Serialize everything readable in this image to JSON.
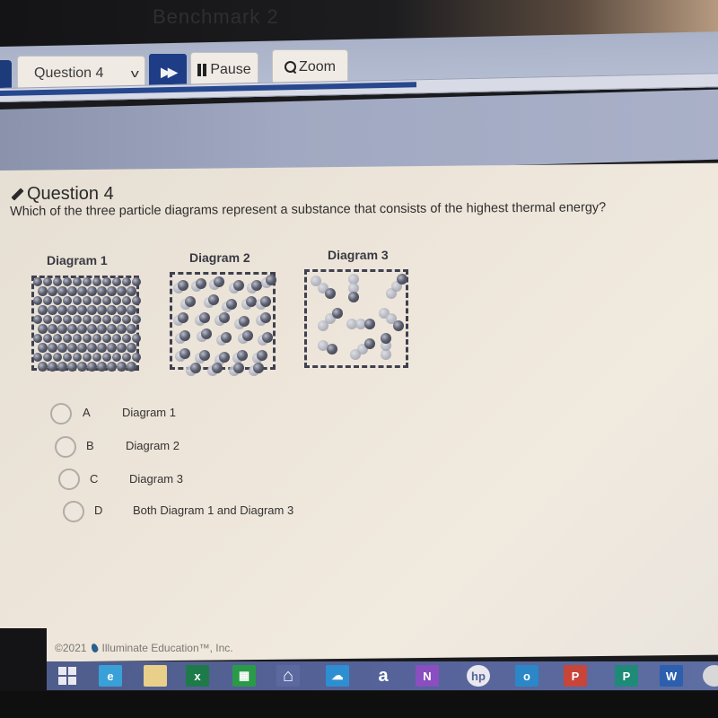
{
  "window": {
    "title_faint": "Benchmark 2"
  },
  "toolbar": {
    "question_select": "Question 4",
    "next_icon": "fast-forward-icon",
    "pause_label": "Pause",
    "zoom_label": "Zoom",
    "progress_fraction": 0.58
  },
  "question": {
    "header": "Question 4",
    "header_icon": "pencil-icon",
    "text": "Which of the three particle diagrams represent a substance that consists of the highest thermal energy?",
    "diagrams": [
      {
        "label": "Diagram 1",
        "state": "solid"
      },
      {
        "label": "Diagram 2",
        "state": "liquid"
      },
      {
        "label": "Diagram 3",
        "state": "gas"
      }
    ],
    "options": [
      {
        "letter": "A",
        "text": "Diagram 1",
        "selected": false
      },
      {
        "letter": "B",
        "text": "Diagram 2",
        "selected": false
      },
      {
        "letter": "C",
        "text": "Diagram 3",
        "selected": false
      },
      {
        "letter": "D",
        "text": "Both Diagram 1 and Diagram 3",
        "selected": false
      }
    ]
  },
  "footer": {
    "copyright": "©2021",
    "company": "Illuminate Education™, Inc."
  },
  "taskbar": {
    "icons": [
      {
        "name": "windows-start-icon",
        "glyph": "",
        "color": "#e9e9f2"
      },
      {
        "name": "internet-explorer-icon",
        "glyph": "e",
        "color": "#3aa0d8"
      },
      {
        "name": "file-explorer-icon",
        "glyph": "",
        "color": "#e8cf8a"
      },
      {
        "name": "excel-icon",
        "glyph": "x",
        "color": "#1f7a4a"
      },
      {
        "name": "store-icon",
        "glyph": "▦",
        "color": "#2b9a48"
      },
      {
        "name": "home-icon",
        "glyph": "⌂",
        "color": "#5b69a0"
      },
      {
        "name": "onedrive-icon",
        "glyph": "☁",
        "color": "#2e8ed2"
      },
      {
        "name": "amazon-icon",
        "glyph": "a",
        "color": "#55639a"
      },
      {
        "name": "onenote-icon",
        "glyph": "N",
        "color": "#8a4ec0"
      },
      {
        "name": "hp-icon",
        "glyph": "hp",
        "color": "#e8e8ee"
      },
      {
        "name": "outlook-icon",
        "glyph": "o",
        "color": "#2b87c8"
      },
      {
        "name": "powerpoint-icon",
        "glyph": "P",
        "color": "#c8453a"
      },
      {
        "name": "publisher-icon",
        "glyph": "P",
        "color": "#1f8a78"
      },
      {
        "name": "word-icon",
        "glyph": "W",
        "color": "#2c5fae"
      },
      {
        "name": "chrome-icon",
        "glyph": "",
        "color": "#d8d8d8"
      }
    ]
  }
}
